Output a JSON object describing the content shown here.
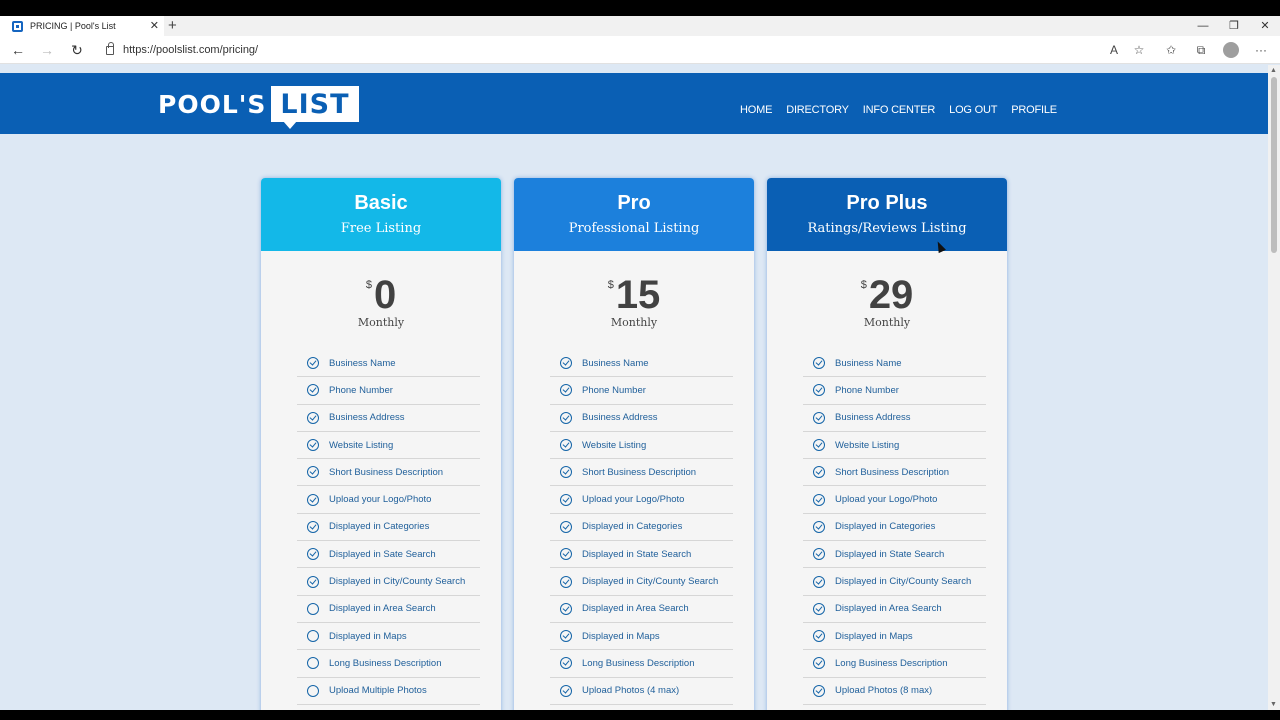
{
  "browser": {
    "tab_title": "PRICING | Pool's List",
    "tab_close": "✕",
    "new_tab": "+",
    "url": "https://poolslist.com/pricing/",
    "window_minimize": "—",
    "window_restore": "❐",
    "window_close": "✕",
    "back": "←",
    "forward": "→",
    "refresh": "↻",
    "more": "···",
    "read_aloud": "A",
    "favorite": "☆",
    "favorites": "✩",
    "collections": "⧉"
  },
  "site": {
    "logo_part1": "POOL'S",
    "logo_part2": "LIST",
    "nav": [
      "HOME",
      "DIRECTORY",
      "INFO CENTER",
      "LOG OUT",
      "PROFILE"
    ]
  },
  "colors": {
    "header": "#0a5fb4",
    "basic": "#13b8e8",
    "pro": "#1c80dc",
    "pro_plus": "#0a5fb4"
  },
  "plans": [
    {
      "name": "Basic",
      "subtitle": "Free Listing",
      "currency": "$",
      "price": "0",
      "period": "Monthly",
      "features": [
        {
          "label": "Business Name",
          "included": true
        },
        {
          "label": "Phone Number",
          "included": true
        },
        {
          "label": "Business Address",
          "included": true
        },
        {
          "label": "Website Listing",
          "included": true
        },
        {
          "label": "Short Business Description",
          "included": true
        },
        {
          "label": "Upload your Logo/Photo",
          "included": true
        },
        {
          "label": "Displayed in Categories",
          "included": true
        },
        {
          "label": "Displayed in Sate Search",
          "included": true
        },
        {
          "label": "Displayed in City/County Search",
          "included": true
        },
        {
          "label": "Displayed in Area Search",
          "included": false
        },
        {
          "label": "Displayed in Maps",
          "included": false
        },
        {
          "label": "Long Business Description",
          "included": false
        },
        {
          "label": "Upload Multiple Photos",
          "included": false
        }
      ]
    },
    {
      "name": "Pro",
      "subtitle": "Professional Listing",
      "currency": "$",
      "price": "15",
      "period": "Monthly",
      "features": [
        {
          "label": "Business Name",
          "included": true
        },
        {
          "label": "Phone Number",
          "included": true
        },
        {
          "label": "Business Address",
          "included": true
        },
        {
          "label": "Website Listing",
          "included": true
        },
        {
          "label": "Short Business Description",
          "included": true
        },
        {
          "label": "Upload your Logo/Photo",
          "included": true
        },
        {
          "label": "Displayed in Categories",
          "included": true
        },
        {
          "label": "Displayed in State Search",
          "included": true
        },
        {
          "label": "Displayed in City/County Search",
          "included": true
        },
        {
          "label": "Displayed in Area Search",
          "included": true
        },
        {
          "label": "Displayed in Maps",
          "included": true
        },
        {
          "label": "Long Business Description",
          "included": true
        },
        {
          "label": "Upload Photos (4 max)",
          "included": true
        }
      ]
    },
    {
      "name": "Pro Plus",
      "subtitle": "Ratings/Reviews Listing",
      "currency": "$",
      "price": "29",
      "period": "Monthly",
      "features": [
        {
          "label": "Business Name",
          "included": true
        },
        {
          "label": "Phone Number",
          "included": true
        },
        {
          "label": "Business Address",
          "included": true
        },
        {
          "label": "Website Listing",
          "included": true
        },
        {
          "label": "Short Business Description",
          "included": true
        },
        {
          "label": "Upload your Logo/Photo",
          "included": true
        },
        {
          "label": "Displayed in Categories",
          "included": true
        },
        {
          "label": "Displayed in State Search",
          "included": true
        },
        {
          "label": "Displayed in City/County Search",
          "included": true
        },
        {
          "label": "Displayed in Area Search",
          "included": true
        },
        {
          "label": "Displayed in Maps",
          "included": true
        },
        {
          "label": "Long Business Description",
          "included": true
        },
        {
          "label": "Upload Photos (8 max)",
          "included": true
        }
      ]
    }
  ]
}
